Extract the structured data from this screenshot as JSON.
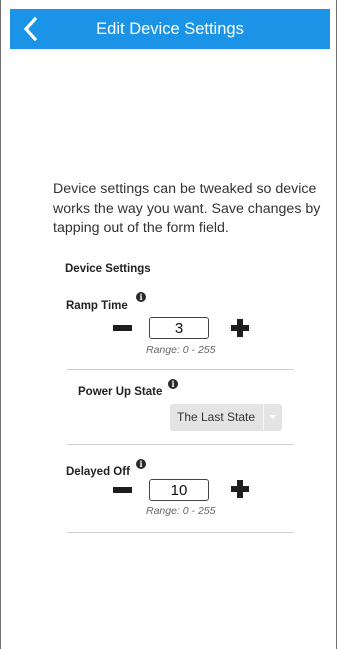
{
  "header": {
    "title": "Edit Device Settings",
    "back_icon": "chevron-left-icon",
    "color": "#1b93e6"
  },
  "intro_text": "Device settings can be tweaked so device works the way you want. Save changes by tapping out of the form field.",
  "section_title": "Device Settings",
  "settings": {
    "ramp_time": {
      "label": "Ramp Time",
      "value": "3",
      "range": "Range: 0 - 255"
    },
    "power_up_state": {
      "label": "Power Up State",
      "selected": "The Last State"
    },
    "delayed_off": {
      "label": "Delayed Off",
      "value": "10",
      "range": "Range: 0 - 255"
    }
  },
  "icons": {
    "info": "info-icon",
    "minus": "minus-icon",
    "plus": "plus-icon",
    "dropdown": "chevron-down-icon"
  }
}
